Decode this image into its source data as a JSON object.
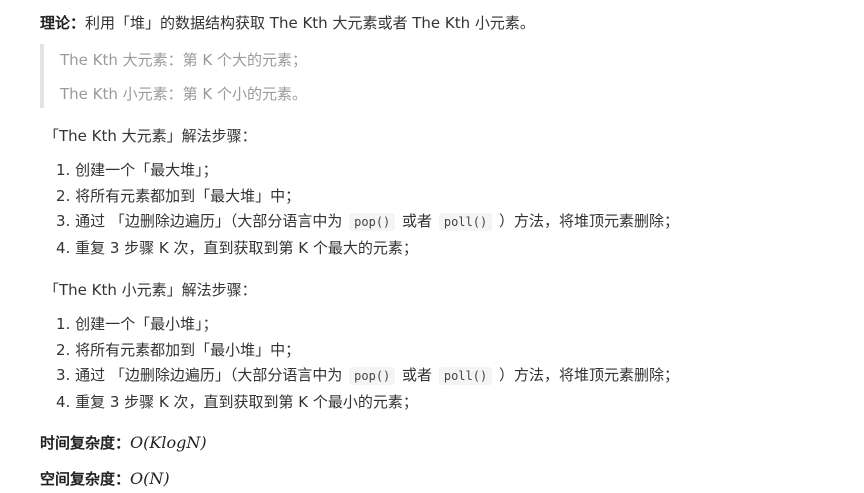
{
  "theory": {
    "label": "理论：",
    "text": "利用「堆」的数据结构获取 The Kth 大元素或者 The Kth 小元素。"
  },
  "quote": [
    "The Kth 大元素：第 K 个大的元素；",
    "The Kth 小元素：第 K 个小的元素。"
  ],
  "largest": {
    "heading": "「The Kth 大元素」解法步骤：",
    "steps": {
      "s1": "1. 创建一个「最大堆」；",
      "s2": "2. 将所有元素都加到「最大堆」中；",
      "s3_prefix": "3. 通过 「边删除边遍历」（大部分语言中为",
      "s3_code1": "pop()",
      "s3_mid": "或者",
      "s3_code2": "poll()",
      "s3_suffix": "）方法，将堆顶元素删除；",
      "s4": "4. 重复 3 步骤 K 次，直到获取到第 K 个最大的元素；"
    }
  },
  "smallest": {
    "heading": "「The Kth 小元素」解法步骤：",
    "steps": {
      "s1": "1. 创建一个「最小堆」；",
      "s2": "2. 将所有元素都加到「最小堆」中；",
      "s3_prefix": "3. 通过 「边删除边遍历」（大部分语言中为",
      "s3_code1": "pop()",
      "s3_mid": "或者",
      "s3_code2": "poll()",
      "s3_suffix": "）方法，将堆顶元素删除；",
      "s4": "4. 重复 3 步骤 K 次，直到获取到第 K 个最小的元素；"
    }
  },
  "complexity": {
    "time_label": "时间复杂度：",
    "time_value": "O(KlogN)",
    "space_label": "空间复杂度：",
    "space_value": "O(N)"
  }
}
